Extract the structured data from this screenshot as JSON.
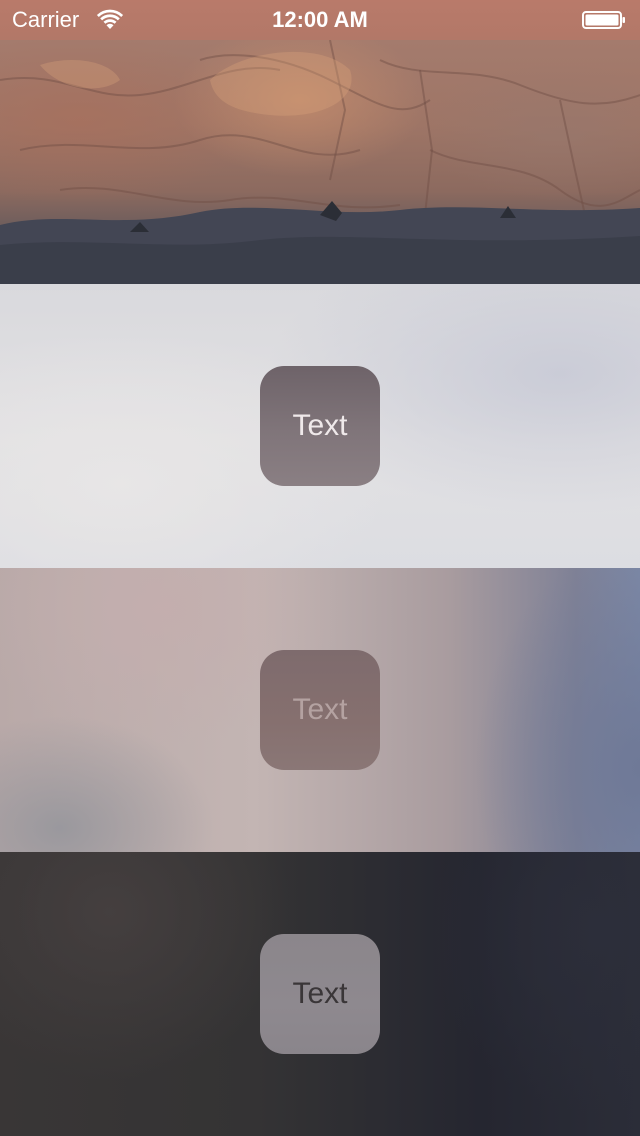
{
  "status_bar": {
    "carrier": "Carrier",
    "time": "12:00 AM",
    "icons": [
      "wifi-icon",
      "battery-icon"
    ]
  },
  "background_photo": {
    "subject": "rocky cliff"
  },
  "panels": [
    {
      "tile_label": "Text"
    },
    {
      "tile_label": "Text"
    },
    {
      "tile_label": "Text"
    }
  ],
  "colors": {
    "status_bar": "#b97a6a",
    "panel_light": "#e0dfe2",
    "panel_extralight": "#b8aaa9",
    "panel_dark": "#323134"
  }
}
